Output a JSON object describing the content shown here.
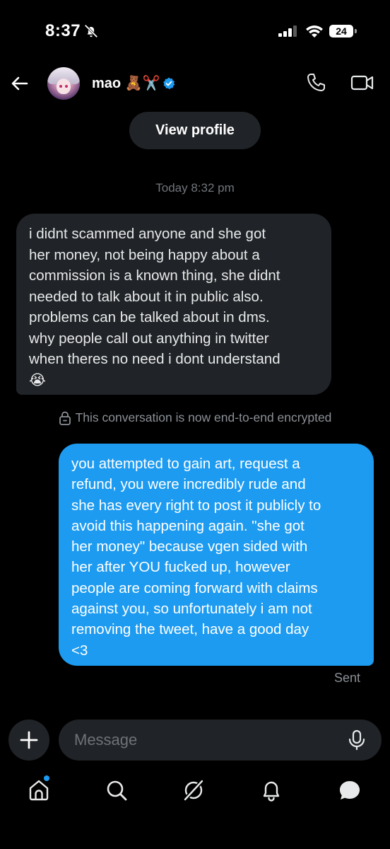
{
  "status_bar": {
    "time": "8:37",
    "battery": "24"
  },
  "header": {
    "contact_name": "mao 🧸✂️",
    "verified": true
  },
  "view_profile_label": "View profile",
  "conversation": {
    "timestamp": "Today 8:32 pm",
    "incoming": {
      "lines": [
        "i didnt scammed anyone and she got",
        "her money, not being happy about a",
        "commission is a known thing, she didnt",
        "needed to talk about it in public also.",
        "problems can be talked about in dms.",
        "why people call out anything in twitter",
        "when theres no need i dont understand",
        "😭"
      ]
    },
    "encryption_notice": "This conversation is now end-to-end encrypted",
    "outgoing": {
      "lines": [
        "you attempted to gain art, request a",
        "refund, you were incredibly rude and",
        "she has every right to post it publicly to",
        "avoid this happening again. \"she got",
        "her money\" because vgen sided with",
        "her after YOU fucked up,  however",
        "people are coming forward with claims",
        "against you, so unfortunately i am not",
        "removing the tweet, have a good day",
        "<3"
      ],
      "status": "Sent"
    }
  },
  "composer": {
    "placeholder": "Message"
  },
  "colors": {
    "accent": "#1d9bf0",
    "bubble_incoming": "#202327",
    "background": "#000000"
  }
}
